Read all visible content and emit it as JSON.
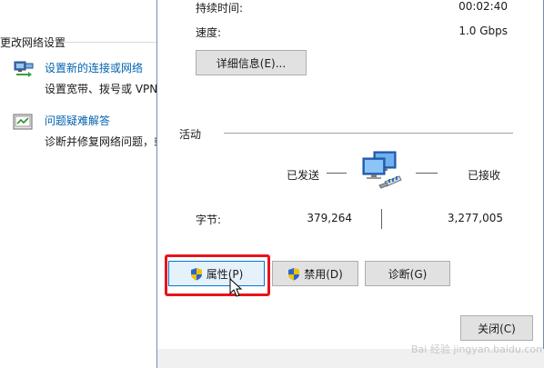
{
  "background": {
    "section_title": "更改网络设置",
    "items": [
      {
        "link": "设置新的连接或网络",
        "description": "设置宽带、拨号或 VPN",
        "icon": "network-setup-icon"
      },
      {
        "link": "问题疑难解答",
        "description": "诊断并修复网络问题，或",
        "icon": "troubleshoot-icon"
      }
    ]
  },
  "dialog": {
    "duration_label": "持续时间:",
    "duration_value": "00:02:40",
    "speed_label": "速度:",
    "speed_value": "1.0 Gbps",
    "details_button": "详细信息(E)...",
    "activity_title": "活动",
    "sent_label": "已发送",
    "received_label": "已接收",
    "bytes_label": "字节:",
    "bytes_sent": "379,264",
    "bytes_received": "3,277,005",
    "buttons": {
      "properties": "属性(P)",
      "disable": "禁用(D)",
      "diagnose": "诊断(G)",
      "close": "关闭(C)"
    }
  },
  "colors": {
    "link": "#0063b1",
    "highlight": "#e8141b",
    "focus_border": "#0078d7"
  }
}
